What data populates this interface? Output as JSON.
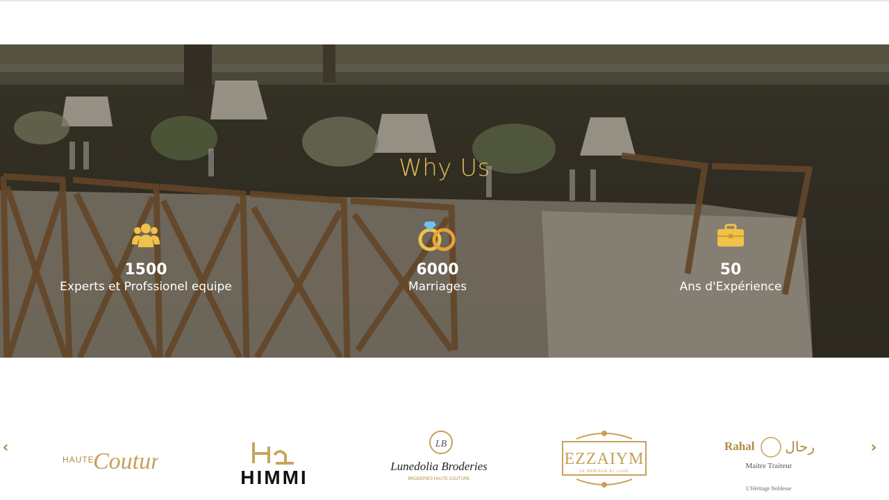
{
  "why_us": {
    "title": "Why Us",
    "stats": [
      {
        "value": "1500",
        "label": "Experts et Profssionel equipe",
        "icon": "users-icon"
      },
      {
        "value": "6000",
        "label": "Marriages",
        "icon": "wedding-rings-icon"
      },
      {
        "value": "50",
        "label": "Ans d'Expérience",
        "icon": "briefcase-icon"
      }
    ]
  },
  "partners": {
    "prev_label": "‹",
    "next_label": "›",
    "logos": [
      {
        "name": "haute-couture",
        "text": "HAUTE",
        "script": "Couture"
      },
      {
        "name": "himmi",
        "text": "HIMMI"
      },
      {
        "name": "lunedolia-broderies",
        "text": "Lunedolia Broderies",
        "sub": "BRODERIES HAUTE COUTURE"
      },
      {
        "name": "ezzaiym",
        "text": "EZZAIYM",
        "sub": "LE MARIAGE ET LUXE"
      },
      {
        "name": "rahal",
        "text": "Rahal",
        "arabic": "رحال",
        "sub": "Maitre Traiteur",
        "tagline": "L'Héritage Noblesse"
      }
    ]
  },
  "colors": {
    "accent": "#e2bd5a",
    "icon": "#f0c24b",
    "arrow": "#b08a3e"
  }
}
